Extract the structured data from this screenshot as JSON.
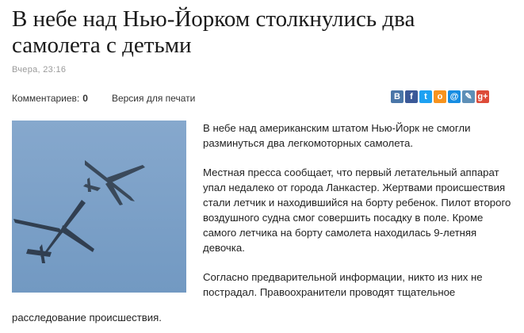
{
  "article": {
    "title": "В небе над Нью-Йорком столкнулись два самолета с детьми",
    "timestamp": "Вчера, 23:16",
    "comments_label": "Комментариев:",
    "comments_count": "0",
    "print_label": "Версия для печати",
    "paragraph_1": "В небе над американским штатом Нью-Йорк не смогли разминуться два легкомоторных самолета.",
    "paragraph_2": "Местная пресса сообщает, что первый летательный аппарат упал недалеко от города Ланкастер. Жертвами происшествия стали летчик и находившийся на борту ребенок. Пилот второго воздушного судна смог совершить посадку в поле. Кроме самого летчика на борту самолета находилась 9-летняя девочка.",
    "paragraph_3_start": "Согласно предварительной информации, никто из них не пострадал. Правоохранители проводят тщательное",
    "paragraph_3_end": "расследование происшествия."
  },
  "share": [
    {
      "icon": "vk-icon",
      "glyph": "В",
      "color": "#4a76a8"
    },
    {
      "icon": "facebook-icon",
      "glyph": "f",
      "color": "#3b5998"
    },
    {
      "icon": "twitter-icon",
      "glyph": "t",
      "color": "#1da1f2"
    },
    {
      "icon": "odnoklassniki-icon",
      "glyph": "о",
      "color": "#f7931e"
    },
    {
      "icon": "mailru-icon",
      "glyph": "@",
      "color": "#168de2"
    },
    {
      "icon": "livejournal-icon",
      "glyph": "✎",
      "color": "#5e8fb7"
    },
    {
      "icon": "google-plus-icon",
      "glyph": "g+",
      "color": "#dd4b39"
    }
  ],
  "photo": {
    "sky_color": "#7ea2c8",
    "plane_color": "#2e3a4b"
  }
}
